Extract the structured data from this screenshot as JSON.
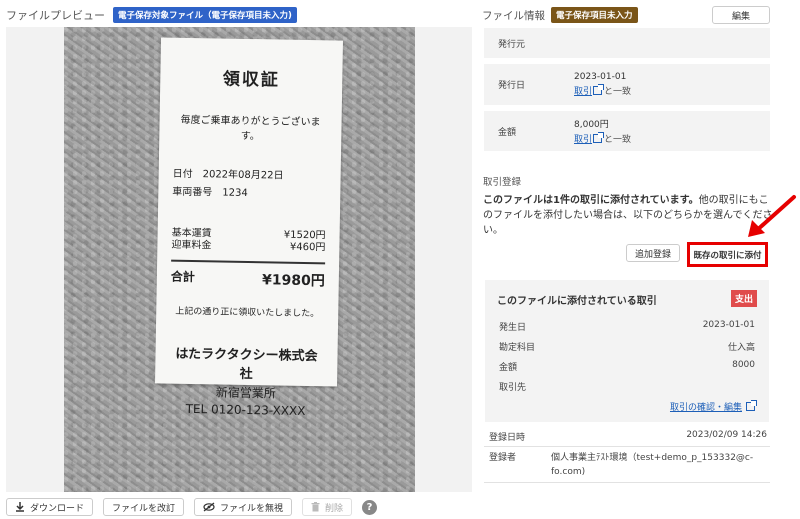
{
  "preview": {
    "title": "ファイルプレビュー",
    "badge": "電子保存対象ファイル（電子保存項目未入力)"
  },
  "receipt": {
    "title": "領収証",
    "thanks": "毎度ご乗車ありがとうございます。",
    "date_label": "日付　2022年08月22日",
    "vehicle_label": "車両番号　1234",
    "fee_base_label": "基本運賃",
    "fee_base_value": "¥1520円",
    "fee_pickup_label": "迎車料金",
    "fee_pickup_value": "¥460円",
    "total_label": "合計",
    "total_value": "¥1980円",
    "note": "上記の通り正に領収いたしました。",
    "company": "はたラクタクシー株式会社",
    "branch": "新宿営業所",
    "tel": "TEL 0120-123-XXXX"
  },
  "bottom_bar": {
    "download": "ダウンロード",
    "revise": "ファイルを改訂",
    "ignore": "ファイルを無視",
    "delete": "削除"
  },
  "info": {
    "title": "ファイル情報",
    "badge": "電子保存項目未入力",
    "edit": "編集",
    "rows": [
      {
        "label": "発行元",
        "value": ""
      },
      {
        "label": "発行日",
        "value": "2023-01-01",
        "link": "取引",
        "match": "と一致"
      },
      {
        "label": "金額",
        "value": "8,000円",
        "link": "取引",
        "match": "と一致"
      }
    ]
  },
  "transaction": {
    "section_label": "取引登録",
    "desc_bold": "このファイルは1件の取引に添付されています。",
    "desc_rest": "他の取引にもこのファイルを添付したい場合は、以下のどちらかを選んでください。",
    "add_button": "追加登録",
    "attach_button": "既存の取引に添付"
  },
  "card": {
    "title": "このファイルに添付されている取引",
    "badge": "支出",
    "rows": [
      {
        "label": "発生日",
        "value": "2023-01-01"
      },
      {
        "label": "勘定科目",
        "value": "仕入高"
      },
      {
        "label": "金額",
        "value": "8000"
      },
      {
        "label": "取引先",
        "value": ""
      }
    ],
    "link": "取引の確認・編集"
  },
  "meta": {
    "registered_label": "登録日時",
    "registered_value": "2023/02/09 14:26",
    "registrant_label": "登録者",
    "registrant_value": "個人事業主ﾃｽﾄ環境（test+demo_p_153332@c-fo.com)"
  },
  "colors": {
    "badge_blue": "#2f63c8",
    "badge_brown": "#7a5518",
    "badge_red": "#e04b4b",
    "highlight_red": "#e60000",
    "link_blue": "#1d5fb8"
  }
}
